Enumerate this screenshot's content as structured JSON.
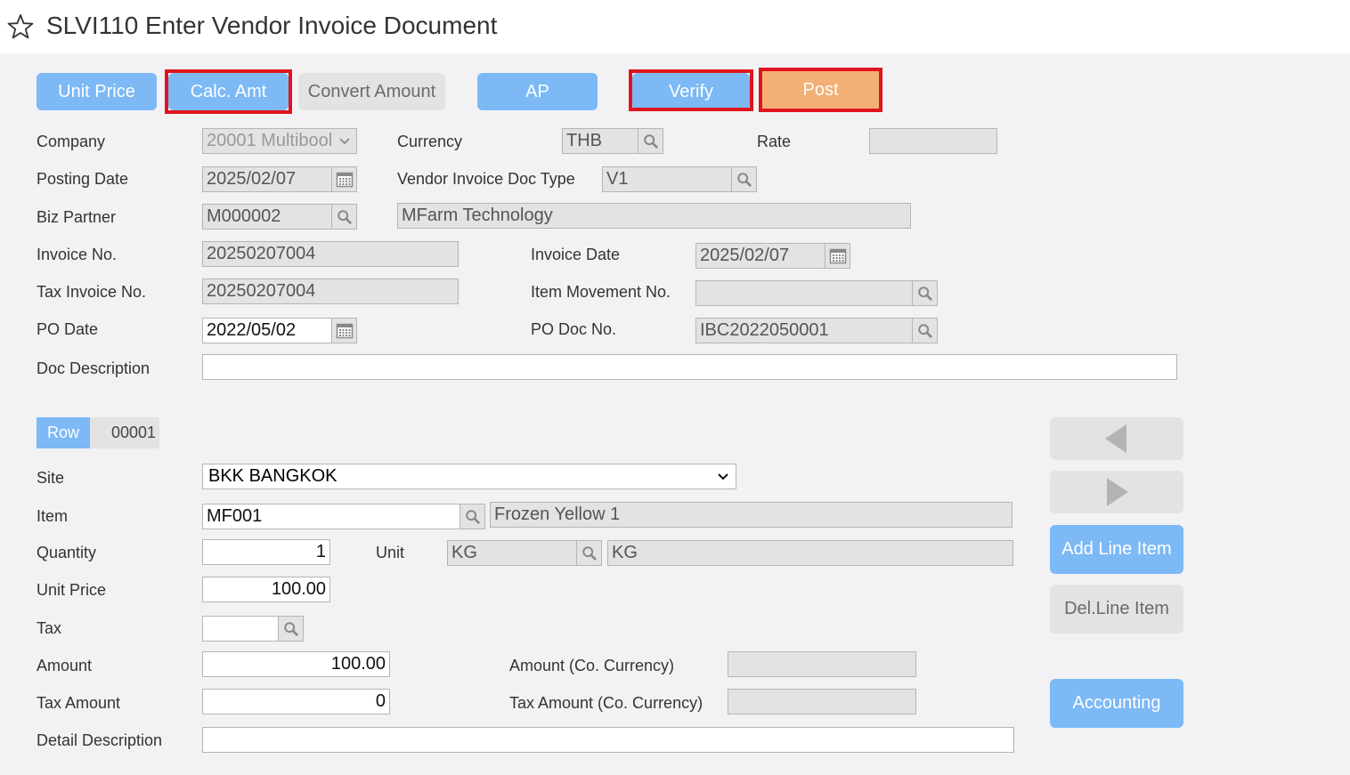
{
  "header": {
    "title": "SLVI110 Enter Vendor Invoice Document"
  },
  "toolbar": {
    "unit_price": "Unit Price",
    "calc_amt": "Calc. Amt",
    "convert_amount": "Convert Amount",
    "ap": "AP",
    "verify": "Verify",
    "post": "Post"
  },
  "form": {
    "company_label": "Company",
    "company_value": "20001 Multibool",
    "currency_label": "Currency",
    "currency_value": "THB",
    "rate_label": "Rate",
    "rate_value": "",
    "posting_date_label": "Posting Date",
    "posting_date_value": "2025/02/07",
    "doc_type_label": "Vendor Invoice Doc Type",
    "doc_type_value": "V1",
    "biz_partner_label": "Biz Partner",
    "biz_partner_code": "M000002",
    "biz_partner_name": "MFarm Technology",
    "invoice_no_label": "Invoice No.",
    "invoice_no_value": "20250207004",
    "invoice_date_label": "Invoice Date",
    "invoice_date_value": "2025/02/07",
    "tax_invoice_label": "Tax Invoice No.",
    "tax_invoice_value": "20250207004",
    "item_movement_label": "Item Movement No.",
    "item_movement_value": "",
    "po_date_label": "PO Date",
    "po_date_value": "2022/05/02",
    "po_doc_label": "PO Doc No.",
    "po_doc_value": "IBC2022050001",
    "doc_desc_label": "Doc Description",
    "doc_desc_value": ""
  },
  "line": {
    "row_label": "Row",
    "row_value": "00001",
    "site_label": "Site",
    "site_value": "BKK BANGKOK",
    "item_label": "Item",
    "item_code": "MF001",
    "item_name": "Frozen Yellow 1",
    "quantity_label": "Quantity",
    "quantity_value": "1",
    "unit_label": "Unit",
    "unit_code": "KG",
    "unit_name": "KG",
    "unit_price_label": "Unit Price",
    "unit_price_value": "100.00",
    "tax_label": "Tax",
    "tax_value": "",
    "amount_label": "Amount",
    "amount_value": "100.00",
    "amount_co_label": "Amount (Co. Currency)",
    "amount_co_value": "",
    "tax_amount_label": "Tax Amount",
    "tax_amount_value": "0",
    "tax_amount_co_label": "Tax Amount (Co. Currency)",
    "tax_amount_co_value": "",
    "detail_desc_label": "Detail Description",
    "detail_desc_value": ""
  },
  "side": {
    "add_line": "Add Line Item",
    "del_line": "Del.Line Item",
    "accounting": "Accounting"
  },
  "icons": [
    "star-icon",
    "search-icon",
    "calendar-icon",
    "chevron-down-icon",
    "arrow-left-icon",
    "arrow-right-icon"
  ],
  "colors": {
    "primary": "#7cb9f5",
    "post": "#f3b076",
    "highlight": "#e0141e",
    "disabled": "#e3e3e3"
  }
}
